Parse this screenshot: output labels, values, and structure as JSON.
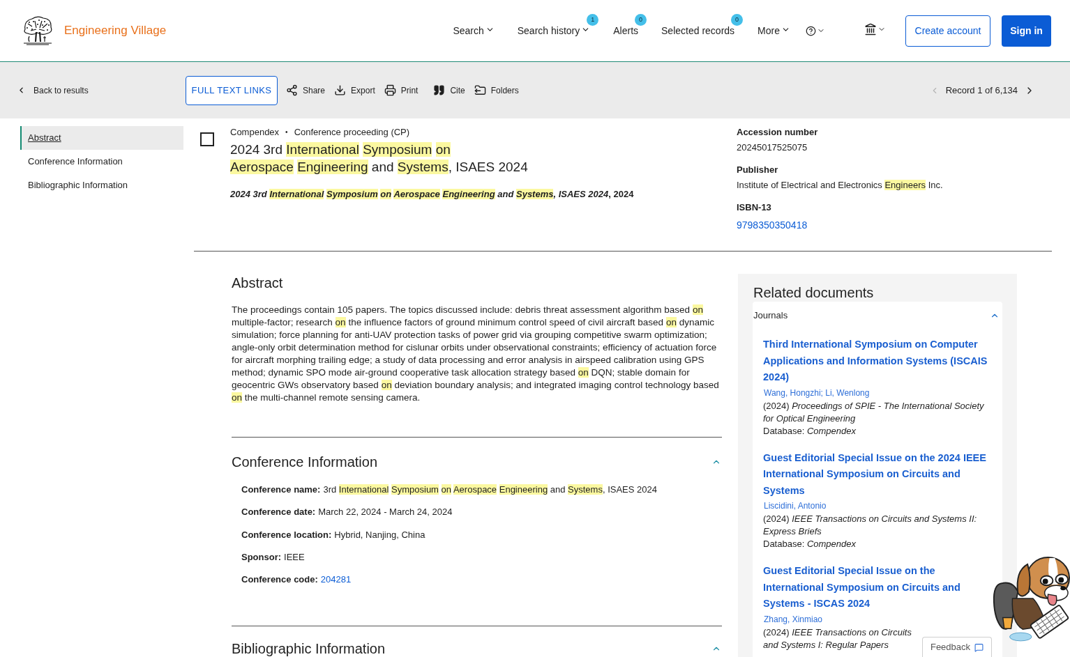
{
  "header": {
    "logo_text": "Engineering Village",
    "nav": [
      {
        "label": "Search",
        "kind": "dropdown"
      },
      {
        "label": "Search history",
        "kind": "dropdown",
        "badge": "1"
      },
      {
        "label": "Alerts",
        "kind": "link",
        "badge": "0"
      },
      {
        "label": "Selected records",
        "kind": "link",
        "badge": "0"
      },
      {
        "label": "More",
        "kind": "dropdown"
      }
    ],
    "buttons": [
      {
        "label": "Create account",
        "kind": "outline"
      },
      {
        "label": "Sign in",
        "kind": "primary"
      }
    ]
  },
  "toolbar": {
    "back": "Back to results",
    "full_text_button": "FULL TEXT LINKS",
    "actions": [
      "Share",
      "Export",
      "Print",
      "Cite",
      "Folders"
    ],
    "record_nav": {
      "label": "Record 1 of 6,134",
      "prev_disabled": true,
      "next_disabled": false
    }
  },
  "sidebar": {
    "items": [
      {
        "label": "Abstract",
        "selected": true
      },
      {
        "label": "Conference Information",
        "selected": false
      },
      {
        "label": "Bibliographic Information",
        "selected": false
      }
    ]
  },
  "record": {
    "checked": false,
    "database": "Compendex",
    "separator": "•",
    "doc_type": "Conference proceeding (CP)",
    "title_lines": [
      [
        {
          "text": "2024 3rd ",
          "highlighted": false
        },
        {
          "text": "International",
          "highlighted": true
        },
        {
          "text": " Symposium",
          "highlighted": true
        },
        {
          "text": " on",
          "highlighted": true
        }
      ],
      [
        {
          "text": "Aerospace",
          "highlighted": true
        },
        {
          "text": " Engineering",
          "highlighted": true
        },
        {
          "text": " and ",
          "highlighted": false
        },
        {
          "text": "Systems",
          "highlighted": true
        },
        {
          "text": ", ISAES 2024",
          "highlighted": false
        }
      ]
    ],
    "source": {
      "segments": [
        {
          "text": "2024 3rd ",
          "highlighted": false
        },
        {
          "text": "International",
          "highlighted": true
        },
        {
          "text": " Symposium",
          "highlighted": true
        },
        {
          "text": " on",
          "highlighted": true
        },
        {
          "text": " Aerospace",
          "highlighted": true
        },
        {
          "text": " Engineering",
          "highlighted": true
        },
        {
          "text": " and ",
          "highlighted": false
        },
        {
          "text": "Systems",
          "highlighted": true
        },
        {
          "text": ", ISAES 2024",
          "highlighted": false
        }
      ],
      "suffix": ", 2024"
    },
    "details": [
      {
        "label": "Accession number",
        "kind": "text",
        "value": "20245017525075"
      },
      {
        "label": "Publisher",
        "kind": "segments",
        "segments": [
          {
            "text": "Institute of Electrical and Electronics ",
            "highlighted": false
          },
          {
            "text": "Engineers",
            "highlighted": true
          },
          {
            "text": " Inc.",
            "highlighted": false
          }
        ]
      },
      {
        "label": "ISBN-13",
        "kind": "link",
        "value": "9798350350418"
      }
    ]
  },
  "abstract": {
    "heading": "Abstract",
    "segments": [
      {
        "text": "The proceedings contain 105 papers. The topics discussed include: debris threat assessment algorithm based ",
        "highlighted": false
      },
      {
        "text": "on",
        "highlighted": true
      },
      {
        "text": " multiple-factor; research ",
        "highlighted": false
      },
      {
        "text": "on",
        "highlighted": true
      },
      {
        "text": " the influence factors of ground minimum control speed of civil aircraft based ",
        "highlighted": false
      },
      {
        "text": "on",
        "highlighted": true
      },
      {
        "text": " dynamic simulation; force planning for anti-UAV protection tasks of power grid via grouping competitive swarm optimization; angle-only orbit determination method for cislunar orbits under observational constraints; efficiency of actuation force for aircraft morphing trailing edge; a study of data processing and error analysis in airspeed calibration using GPS method; dynamic SPO mode air-ground cooperative task allocation strategy based ",
        "highlighted": false
      },
      {
        "text": "on",
        "highlighted": true
      },
      {
        "text": " DQN; stable domain for geocentric GWs observatory based ",
        "highlighted": false
      },
      {
        "text": "on",
        "highlighted": true
      },
      {
        "text": " deviation boundary analysis; and integrated imaging control technology based ",
        "highlighted": false
      },
      {
        "text": "on",
        "highlighted": true
      },
      {
        "text": " the multi-channel remote sensing camera.",
        "highlighted": false
      }
    ]
  },
  "sections": [
    {
      "heading": "Conference Information",
      "expanded": true,
      "fields": [
        {
          "label": "Conference name:",
          "kind": "segments",
          "segments": [
            {
              "text": "3rd ",
              "highlighted": false
            },
            {
              "text": "International",
              "highlighted": true
            },
            {
              "text": " Symposium",
              "highlighted": true
            },
            {
              "text": " on",
              "highlighted": true
            },
            {
              "text": " Aerospace",
              "highlighted": true
            },
            {
              "text": " Engineering",
              "highlighted": true
            },
            {
              "text": " and ",
              "highlighted": false
            },
            {
              "text": "Systems",
              "highlighted": true
            },
            {
              "text": ", ISAES 2024",
              "highlighted": false
            }
          ]
        },
        {
          "label": "Conference date:",
          "kind": "text",
          "value": "March 22, 2024 - March 24, 2024"
        },
        {
          "label": "Conference location:",
          "kind": "text",
          "value": "Hybrid, Nanjing, China"
        },
        {
          "label": "Sponsor:",
          "kind": "text",
          "value": "IEEE"
        },
        {
          "label": "Conference code:",
          "kind": "link",
          "value": "204281"
        }
      ]
    },
    {
      "heading": "Bibliographic Information",
      "expanded": true
    }
  ],
  "related": {
    "heading": "Related documents",
    "group": {
      "label": "Journals",
      "expanded": true
    },
    "items": [
      {
        "title": "Third International Symposium on Computer Applications and Information Systems (ISCAIS 2024)",
        "authors": "Wang, Hongzhi; Li, Wenlong",
        "year": "(2024)",
        "journal": "Proceedings of SPIE - The International Society for Optical Engineering",
        "database_label": "Database:",
        "database": "Compendex"
      },
      {
        "title": "Guest Editorial Special Issue on the 2024 IEEE International Symposium on Circuits and Systems",
        "authors": "Liscidini, Antonio",
        "year": "(2024)",
        "journal": "IEEE Transactions on Circuits and Systems II: Express Briefs",
        "database_label": "Database:",
        "database": "Compendex"
      },
      {
        "title": "Guest Editorial Special Issue on the International Symposium on Circuits and Systems - ISCAS 2024",
        "authors": "Zhang, Xinmiao",
        "year": "(2024)",
        "journal": "IEEE Transactions on Circuits and Systems I: Regular Papers"
      }
    ]
  },
  "feedback_button": "Feedback"
}
